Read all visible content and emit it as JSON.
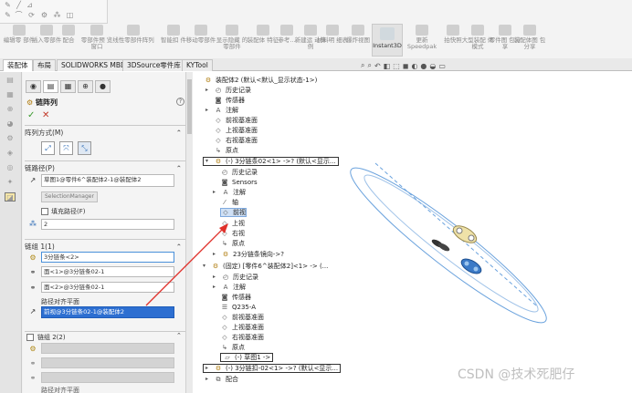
{
  "ribbon": {
    "buttons": [
      {
        "label": "编辑零\n部件"
      },
      {
        "label": "插入零部件"
      },
      {
        "label": "配合"
      },
      {
        "label": "零部件预\n览窗口"
      },
      {
        "label": "线性零部件阵列"
      },
      {
        "label": "智能扣\n件"
      },
      {
        "label": "移动零部件"
      },
      {
        "label": "显示隐藏\n的零部件"
      },
      {
        "label": "装配体\n特征"
      },
      {
        "label": "参考..."
      },
      {
        "label": "新建运\n动算例"
      },
      {
        "label": "材料明\n细表"
      },
      {
        "label": "爆炸视图"
      },
      {
        "label": "更新\nSpeedpak"
      },
      {
        "label": "拍快照"
      },
      {
        "label": "大型装配\n体模式"
      },
      {
        "label": "零件图\n包分享"
      },
      {
        "label": "装配体图\n包分享"
      }
    ],
    "instant3d": "Instant3D"
  },
  "tabs": [
    "装配体",
    "布局",
    "SOLIDWORKS MBD",
    "3DSource零件库",
    "KYTool"
  ],
  "property_manager": {
    "title": "链阵列",
    "pattern_method_label": "阵列方式(M)",
    "chain_path_label": "链路径(P)",
    "path_value": "草图1@零件6^装配体2-1@装配体2",
    "selection_manager": "SelectionManager",
    "fill_path": "填充路径(F)",
    "count_value": "2",
    "chain_group1_label": "链组 1(1)",
    "group1_field1": "3分链条<2>",
    "group1_field2": "面<1>@3分链条02-1",
    "group1_field3": "面<2>@3分链条02-1",
    "path_plane_label": "路径对齐平面",
    "path_plane_value": "前视@3分链条02-1@装配体2",
    "chain_group2_label": "链组 2(2)",
    "path_plane_label2": "路径对齐平面"
  },
  "tree": {
    "root": "装配体2 (默认<默认_显示状态-1>)",
    "items": [
      "历史记录",
      "传感器",
      "注解",
      "前视基准面",
      "上视基准面",
      "右视基准面",
      "原点",
      "(-) 3分链条02<1> ->? (默认<显示...",
      "历史记录",
      "Sensors",
      "注解",
      "轴",
      "前视",
      "上视",
      "右视",
      "原点",
      "23分链条镜向->?",
      "(固定) [零件6^装配体2]<1> -> (...",
      "历史记录",
      "注解",
      "传感器",
      "Q235-A",
      "前视基准面",
      "上视基准面",
      "右视基准面",
      "原点",
      "(-) 草图1 ->",
      "(-) 3分链扣-02<1> ->? (默认<显示...",
      "配合"
    ]
  },
  "watermark": "CSDN @技术死肥仔"
}
